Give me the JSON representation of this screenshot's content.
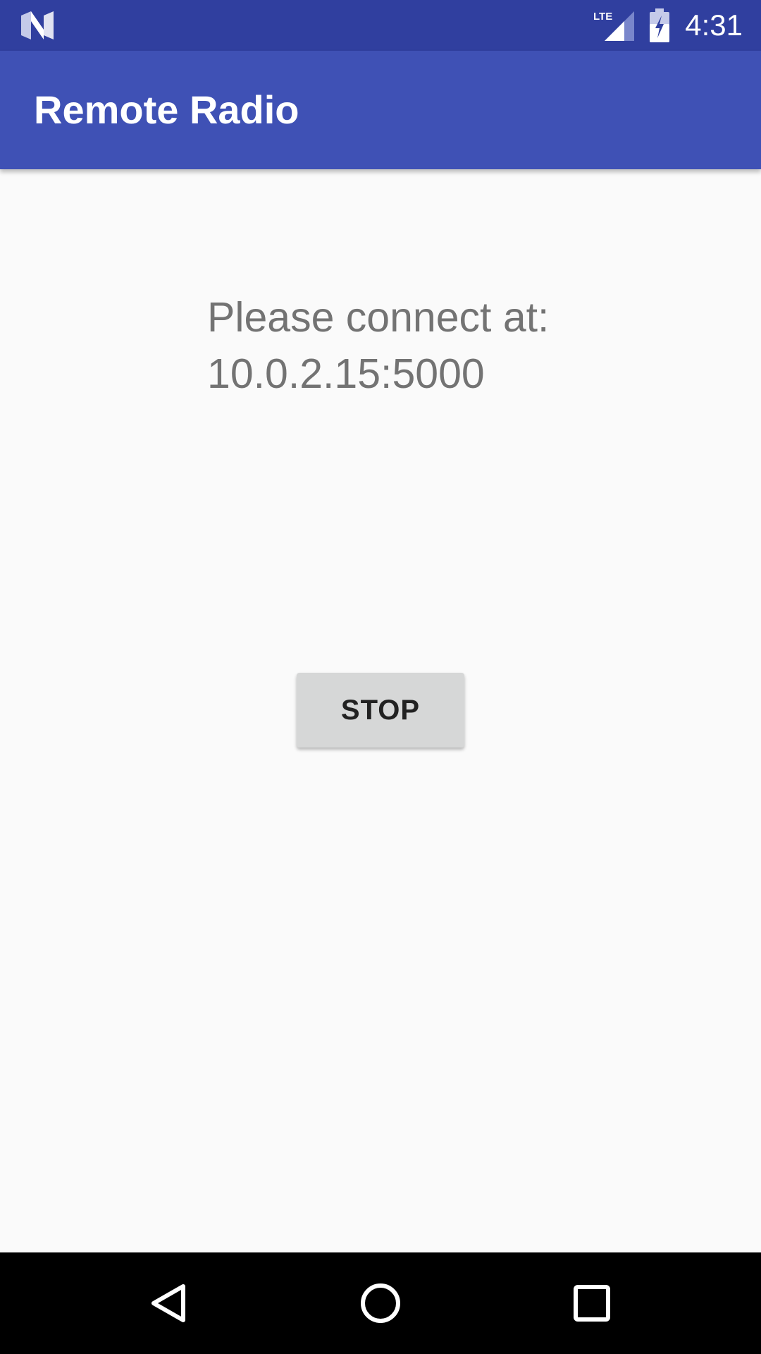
{
  "status_bar": {
    "time": "4:31",
    "network_label": "LTE",
    "icons": [
      "n-logo-icon",
      "lte-signal-icon",
      "battery-charging-icon"
    ],
    "color": "#303f9f"
  },
  "app_bar": {
    "title": "Remote Radio",
    "color": "#3f51b5"
  },
  "main": {
    "connect_prompt": "Please connect at:",
    "address": "10.0.2.15:5000",
    "stop_button_label": "STOP"
  },
  "nav_bar": {
    "icons": [
      "back-icon",
      "home-icon",
      "recents-icon"
    ]
  }
}
